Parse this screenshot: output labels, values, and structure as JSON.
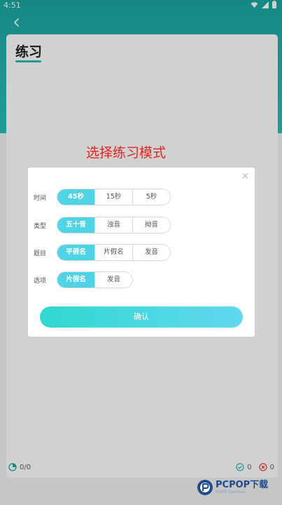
{
  "status": {
    "time": "4:51"
  },
  "header": {
    "title": "练习"
  },
  "footer": {
    "progress": "0/0",
    "correct_count": "0",
    "wrong_count": "0"
  },
  "caption": "选择练习模式",
  "dialog": {
    "close_glyph": "×",
    "rows": [
      {
        "label": "时间",
        "options": [
          "45秒",
          "15秒",
          "5秒"
        ],
        "selected": "45秒"
      },
      {
        "label": "类型",
        "options": [
          "五十音",
          "浊音",
          "拗音"
        ],
        "selected": "五十音"
      },
      {
        "label": "题目",
        "options": [
          "平假名",
          "片假名",
          "发音"
        ],
        "selected": "平假名"
      },
      {
        "label": "选项",
        "options": [
          "片假名",
          "发音"
        ],
        "selected": "片假名"
      }
    ],
    "confirm_label": "确认"
  },
  "watermark": {
    "main": "PCPOP下载",
    "sub": "PCPOP Download"
  },
  "colors": {
    "teal_header": "#1aa7a2",
    "accent_selected": "#50d3e4",
    "caption_red": "#e8231f"
  },
  "icons": {
    "back": "chevron-left-icon",
    "progress": "pie-icon",
    "correct": "check-circle-icon",
    "wrong": "x-circle-icon",
    "close": "close-icon"
  }
}
